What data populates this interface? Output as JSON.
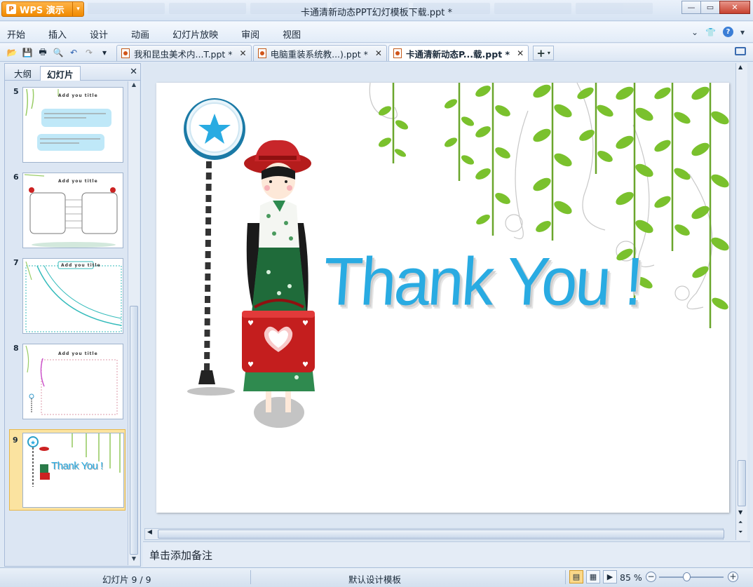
{
  "app": {
    "button_label": "WPS 演示",
    "window_title": "卡通清新动态PPT幻灯模板下载.ppt *"
  },
  "menu": [
    "开始",
    "插入",
    "设计",
    "动画",
    "幻灯片放映",
    "审阅",
    "视图"
  ],
  "doc_tabs": [
    {
      "label": "我和昆虫美术内...T.ppt *",
      "active": false
    },
    {
      "label": "电脑重装系统教...).ppt *",
      "active": false
    },
    {
      "label": "卡通清新动态P...载.ppt *",
      "active": true
    }
  ],
  "left_panel": {
    "tab_outline": "大纲",
    "tab_slides": "幻灯片",
    "slides": [
      {
        "number": "5",
        "title": "Add you title"
      },
      {
        "number": "6",
        "title": "Add you title"
      },
      {
        "number": "7",
        "title": "Add you title"
      },
      {
        "number": "8",
        "title": "Add you title"
      },
      {
        "number": "9",
        "title": "Thank You !",
        "selected": true
      }
    ]
  },
  "slide": {
    "heading": "Thank You !",
    "accent_color": "#29abe2"
  },
  "notes_placeholder": "单击添加备注",
  "status": {
    "slide_counter": "幻灯片 9 / 9",
    "template": "默认设计模板",
    "zoom": "85 %"
  }
}
